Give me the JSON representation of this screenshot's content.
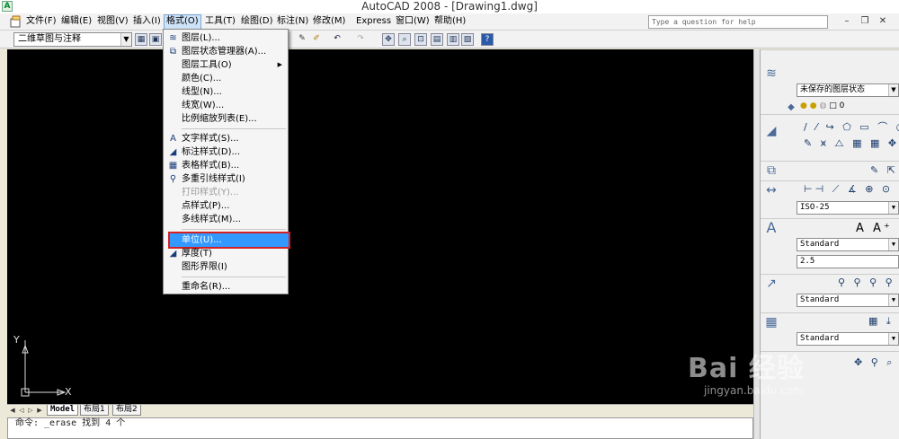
{
  "window": {
    "title": "AutoCAD 2008 - [Drawing1.dwg]",
    "app_icon": "autocad-icon"
  },
  "menubar": {
    "items": [
      "文件(F)",
      "编辑(E)",
      "视图(V)",
      "插入(I)",
      "格式(O)",
      "工具(T)",
      "绘图(D)",
      "标注(N)",
      "修改(M)",
      "Express",
      "窗口(W)",
      "帮助(H)"
    ],
    "active": "格式(O)",
    "help_placeholder": "Type a question for help"
  },
  "toolbar": {
    "workspace": "二维草图与注释"
  },
  "format_menu": {
    "items": [
      {
        "label": "图层(L)...",
        "icon": "layers-icon"
      },
      {
        "label": "图层状态管理器(A)...",
        "icon": "layer-state-icon"
      },
      {
        "label": "图层工具(O)",
        "submenu": true
      },
      {
        "label": "颜色(C)..."
      },
      {
        "label": "线型(N)..."
      },
      {
        "label": "线宽(W)..."
      },
      {
        "label": "比例缩放列表(E)..."
      },
      {
        "label": "文字样式(S)...",
        "icon": "text-style-icon"
      },
      {
        "label": "标注样式(D)...",
        "icon": "dim-style-icon"
      },
      {
        "label": "表格样式(B)...",
        "icon": "table-style-icon"
      },
      {
        "label": "多重引线样式(I)",
        "icon": "mleader-style-icon"
      },
      {
        "label": "打印样式(Y)...",
        "disabled": true
      },
      {
        "label": "点样式(P)..."
      },
      {
        "label": "多线样式(M)..."
      },
      {
        "label": "单位(U)...",
        "selected": true
      },
      {
        "label": "厚度(T)",
        "icon": "thickness-icon"
      },
      {
        "label": "图形界限(I)"
      },
      {
        "label": "重命名(R)..."
      }
    ]
  },
  "layout_tabs": {
    "tabs": [
      "Model",
      "布局1",
      "布局2"
    ],
    "active": "Model"
  },
  "command_line": {
    "text": "命令: _erase 找到 4 个"
  },
  "ucs": {
    "x_label": "X",
    "y_label": "Y"
  },
  "dashboard": {
    "layer_state": "未保存的图层状态",
    "layer_value": "0",
    "dim_style": "ISO-25",
    "text_style": "Standard",
    "text_height": "2.5",
    "mleader_style": "Standard",
    "table_style": "Standard"
  },
  "watermark": {
    "brand": "Bai 经验",
    "url": "jingyan.baidu.com"
  }
}
